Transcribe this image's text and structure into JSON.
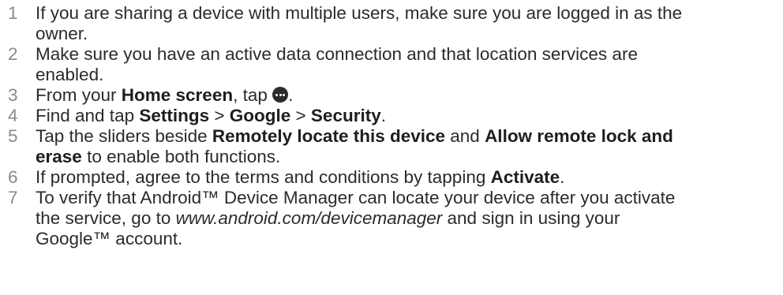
{
  "steps": [
    {
      "number": "1",
      "line1": "If you are sharing a device with multiple users, make sure you are logged in as the",
      "line2": "owner."
    },
    {
      "number": "2",
      "line1": "Make sure you have an active data connection and that location services are",
      "line2": "enabled."
    },
    {
      "number": "3",
      "pre": "From your ",
      "bold1": "Home screen",
      "mid": ", tap ",
      "icon": "apps-icon",
      "post": "."
    },
    {
      "number": "4",
      "pre": "Find and tap ",
      "bold1": "Settings",
      "sep1": " > ",
      "bold2": "Google",
      "sep2": " > ",
      "bold3": "Security",
      "post": "."
    },
    {
      "number": "5",
      "pre": "Tap the sliders beside ",
      "bold1": "Remotely locate this device",
      "mid": " and ",
      "bold2a": "Allow remote lock and",
      "bold2b": "erase",
      "post": " to enable both functions."
    },
    {
      "number": "6",
      "pre": "If prompted, agree to the terms and conditions by tapping ",
      "bold1": "Activate",
      "post": "."
    },
    {
      "number": "7",
      "line1": "To verify that Android™ Device Manager can locate your device after you activate",
      "pre2": "the service, go to ",
      "link": "www.android.com/devicemanager",
      "post2": " and sign in using your",
      "line3": "Google™ account."
    }
  ]
}
